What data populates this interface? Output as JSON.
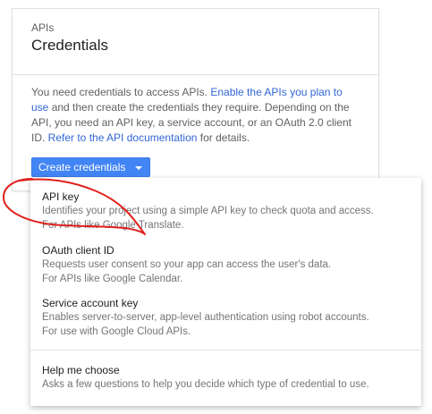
{
  "card": {
    "kicker": "APIs",
    "title": "Credentials",
    "body": {
      "text_1": "You need credentials to access APIs. ",
      "link_1": "Enable the APIs you plan to use",
      "text_2": " and then create the credentials they require. Depending on the API, you need an API key, a service account, or an OAuth 2.0 client ID. ",
      "link_2": "Refer to the API documentation",
      "text_3": " for details."
    },
    "button_label": "Create credentials"
  },
  "dropdown": {
    "items": [
      {
        "title": "API key",
        "desc_line1": "Identifies your project using a simple API key to check quota and access.",
        "desc_line2": "For APIs like Google Translate."
      },
      {
        "title": "OAuth client ID",
        "desc_line1": "Requests user consent so your app can access the user's data.",
        "desc_line2": "For APIs like Google Calendar."
      },
      {
        "title": "Service account key",
        "desc_line1": "Enables server-to-server, app-level authentication using robot accounts.",
        "desc_line2": "For use with Google Cloud APIs."
      },
      {
        "title": "Help me choose",
        "desc_line1": "Asks a few questions to help you decide which type of credential to use."
      }
    ]
  },
  "colors": {
    "accent": "#4285f4",
    "link": "#3367d6",
    "annotation": "#e0201c"
  },
  "icons": {
    "button_caret": "chevron-down-icon"
  }
}
